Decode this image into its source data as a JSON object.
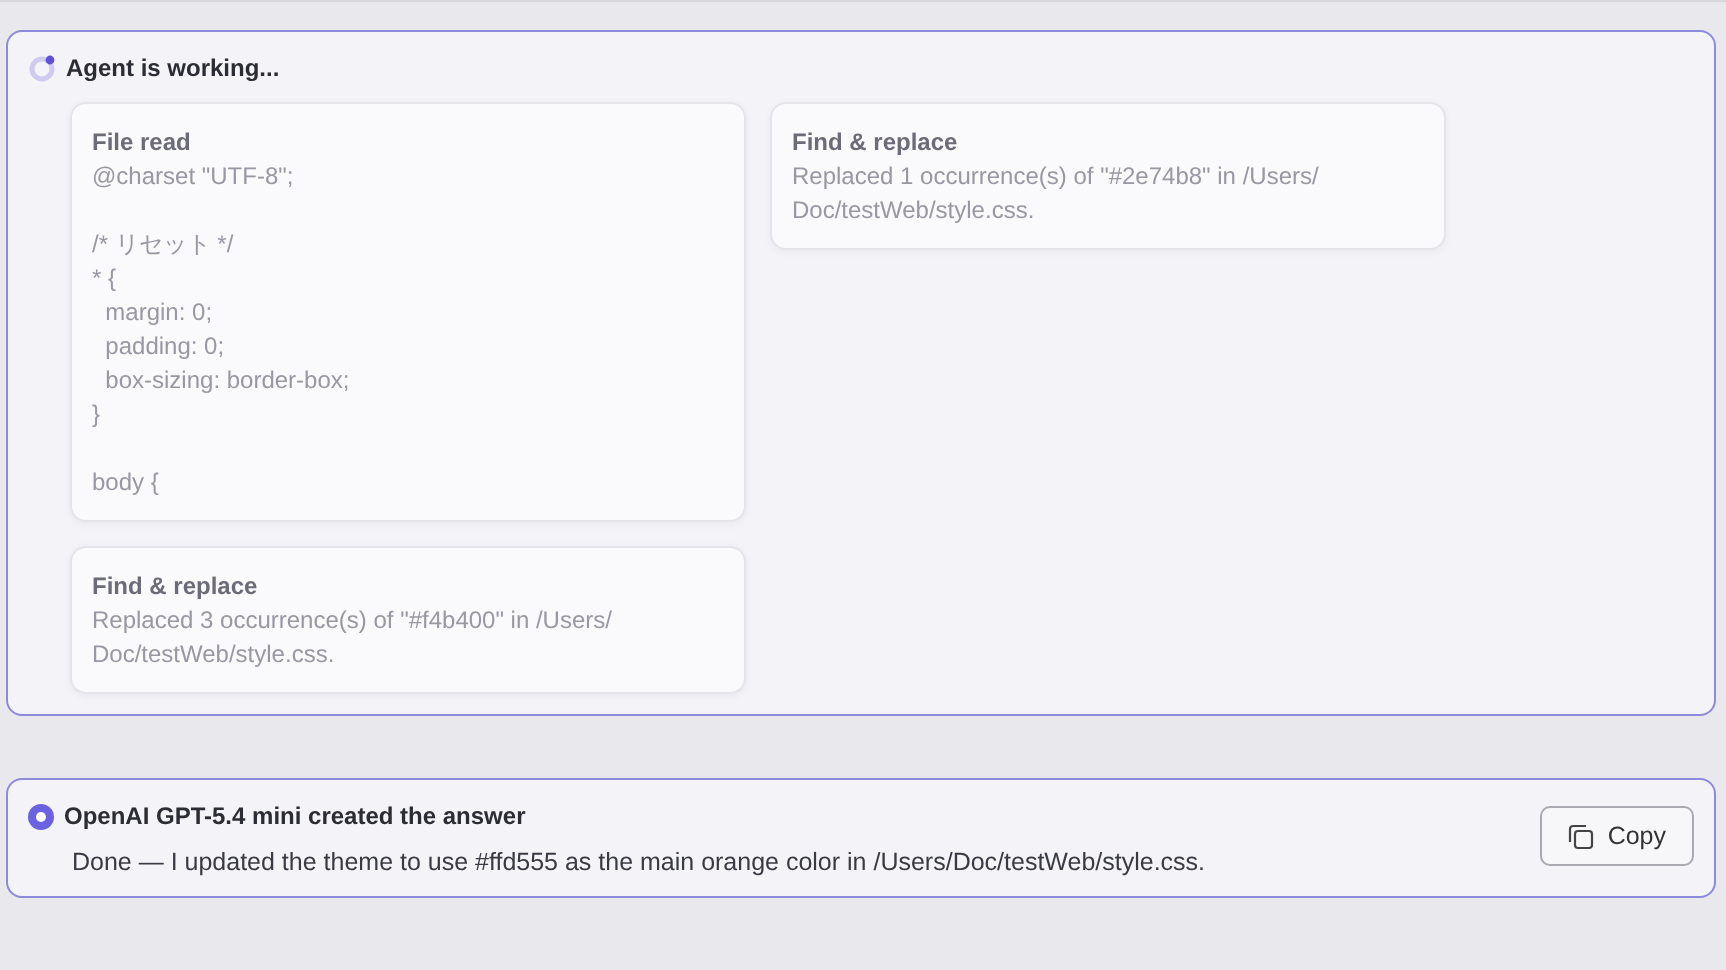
{
  "agent_panel": {
    "status": "Agent is working...",
    "cards": [
      {
        "title": "File read",
        "text": "@charset \"UTF-8\";\n\n/* リセット */\n* {\n  margin: 0;\n  padding: 0;\n  box-sizing: border-box;\n}\n\nbody {"
      },
      {
        "title": "Find & replace",
        "text": "Replaced 1 occurrence(s) of \"#2e74b8\" in /Users/\nDoc/testWeb/style.css."
      },
      {
        "title": "Find & replace",
        "text": "Replaced 3 occurrence(s) of \"#f4b400\" in /Users/\nDoc/testWeb/style.css."
      }
    ]
  },
  "answer_panel": {
    "title": "OpenAI GPT-5.4 mini created the answer",
    "text": "Done — I updated the theme to use #ffd555 as the main orange color in /Users/Doc/testWeb/style.css.",
    "copy_button": "Copy"
  }
}
